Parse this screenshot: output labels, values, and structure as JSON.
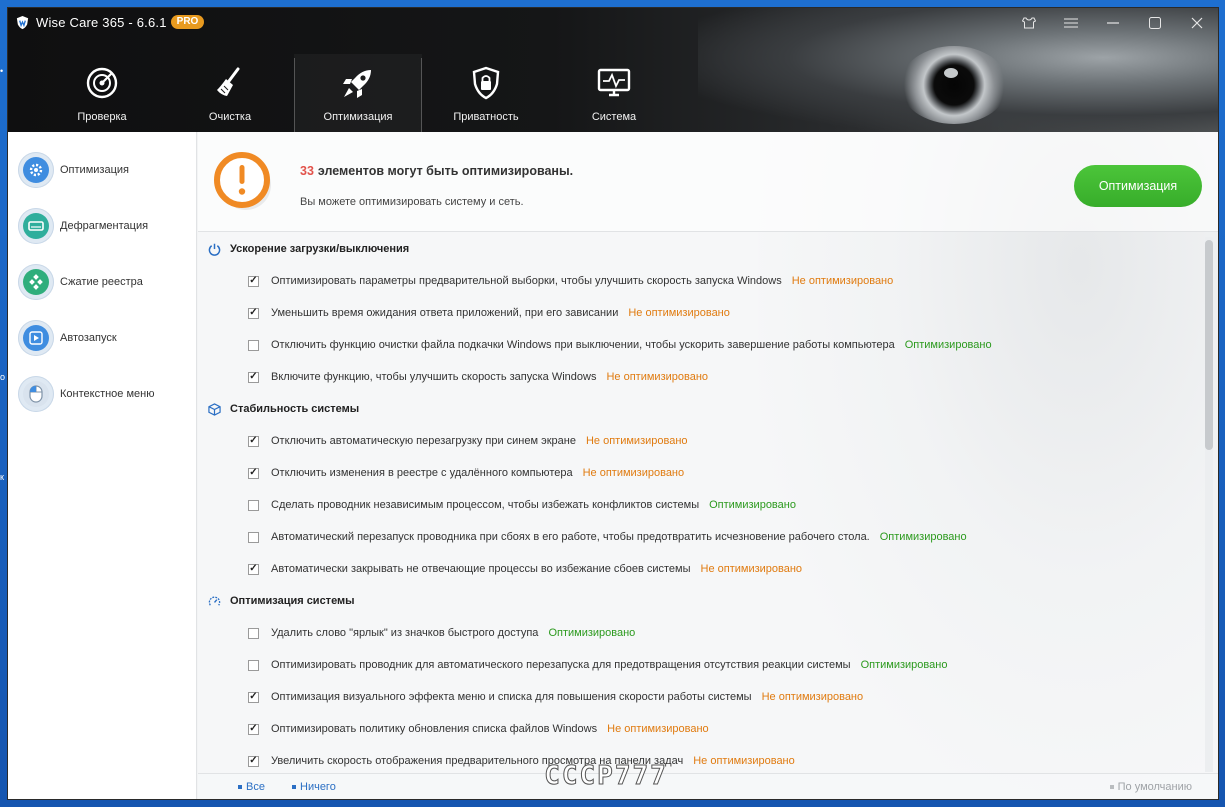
{
  "app": {
    "title": "Wise Care 365 - 6.6.1",
    "badge": "PRO"
  },
  "window_controls": [
    "skin-icon",
    "menu-icon",
    "minimize-icon",
    "maximize-icon",
    "close-icon"
  ],
  "nav": [
    {
      "label": "Проверка",
      "icon": "radar-icon"
    },
    {
      "label": "Очистка",
      "icon": "broom-icon"
    },
    {
      "label": "Оптимизация",
      "icon": "rocket-icon",
      "active": true
    },
    {
      "label": "Приватность",
      "icon": "lock-shield-icon"
    },
    {
      "label": "Система",
      "icon": "monitor-icon"
    }
  ],
  "sidebar": [
    {
      "label": "Оптимизация",
      "icon": "gear-icon"
    },
    {
      "label": "Дефрагментация",
      "icon": "disk-icon"
    },
    {
      "label": "Сжатие реестра",
      "icon": "registry-icon"
    },
    {
      "label": "Автозапуск",
      "icon": "play-icon"
    },
    {
      "label": "Контекстное меню",
      "icon": "mouse-icon"
    }
  ],
  "banner": {
    "count": "33",
    "title": "элементов могут быть оптимизированы.",
    "subtitle": "Вы можете оптимизировать систему и сеть.",
    "button": "Оптимизация"
  },
  "status_labels": {
    "not_optimized": "Не оптимизировано",
    "optimized": "Оптимизировано"
  },
  "colors": {
    "not_optimized": "#e07b10",
    "optimized": "#2c9a1e",
    "accent": "#2b6fc4",
    "button": "#3fb730",
    "warning": "#f08a24"
  },
  "sections": [
    {
      "title": "Ускорение загрузки/выключения",
      "icon": "power-icon",
      "items": [
        {
          "text": "Оптимизировать параметры предварительной выборки, чтобы улучшить скорость запуска Windows",
          "checked": true,
          "status": "Не оптимизировано"
        },
        {
          "text": "Уменьшить время ожидания ответа приложений, при его зависании",
          "checked": true,
          "status": "Не оптимизировано"
        },
        {
          "text": "Отключить функцию очистки файла подкачки Windows при выключении, чтобы ускорить завершение работы компьютера",
          "checked": false,
          "status": "Оптимизировано"
        },
        {
          "text": "Включите функцию, чтобы улучшить скорость запуска Windows",
          "checked": true,
          "status": "Не оптимизировано"
        }
      ]
    },
    {
      "title": "Стабильность системы",
      "icon": "cube-icon",
      "items": [
        {
          "text": "Отключить автоматическую перезагрузку при синем экране",
          "checked": true,
          "status": "Не оптимизировано"
        },
        {
          "text": "Отключить изменения в реестре с удалённого компьютера",
          "checked": true,
          "status": "Не оптимизировано"
        },
        {
          "text": "Сделать проводник независимым процессом, чтобы избежать конфликтов системы",
          "checked": false,
          "status": "Оптимизировано"
        },
        {
          "text": "Автоматический перезапуск проводника при сбоях в его работе, чтобы предотвратить исчезновение рабочего стола.",
          "checked": false,
          "status": "Оптимизировано"
        },
        {
          "text": "Автоматически закрывать не отвечающие процессы во избежание сбоев системы",
          "checked": true,
          "status": "Не оптимизировано"
        }
      ]
    },
    {
      "title": "Оптимизация системы",
      "icon": "speedometer-icon",
      "items": [
        {
          "text": "Удалить слово \"ярлык\" из значков быстрого доступа",
          "checked": false,
          "status": "Оптимизировано"
        },
        {
          "text": "Оптимизировать проводник для автоматического перезапуска для предотвращения отсутствия реакции системы",
          "checked": false,
          "status": "Оптимизировано"
        },
        {
          "text": "Оптимизация визуального эффекта меню и списка для повышения скорости работы системы",
          "checked": true,
          "status": "Не оптимизировано"
        },
        {
          "text": "Оптимизировать политику обновления списка файлов Windows",
          "checked": true,
          "status": "Не оптимизировано"
        },
        {
          "text": "Увеличить скорость отображения предварительного просмотра на панели задач",
          "checked": true,
          "status": "Не оптимизировано"
        }
      ]
    }
  ],
  "footer": {
    "all": "Все",
    "none": "Ничего",
    "default": "По умолчанию"
  },
  "watermark": "CCCP777"
}
